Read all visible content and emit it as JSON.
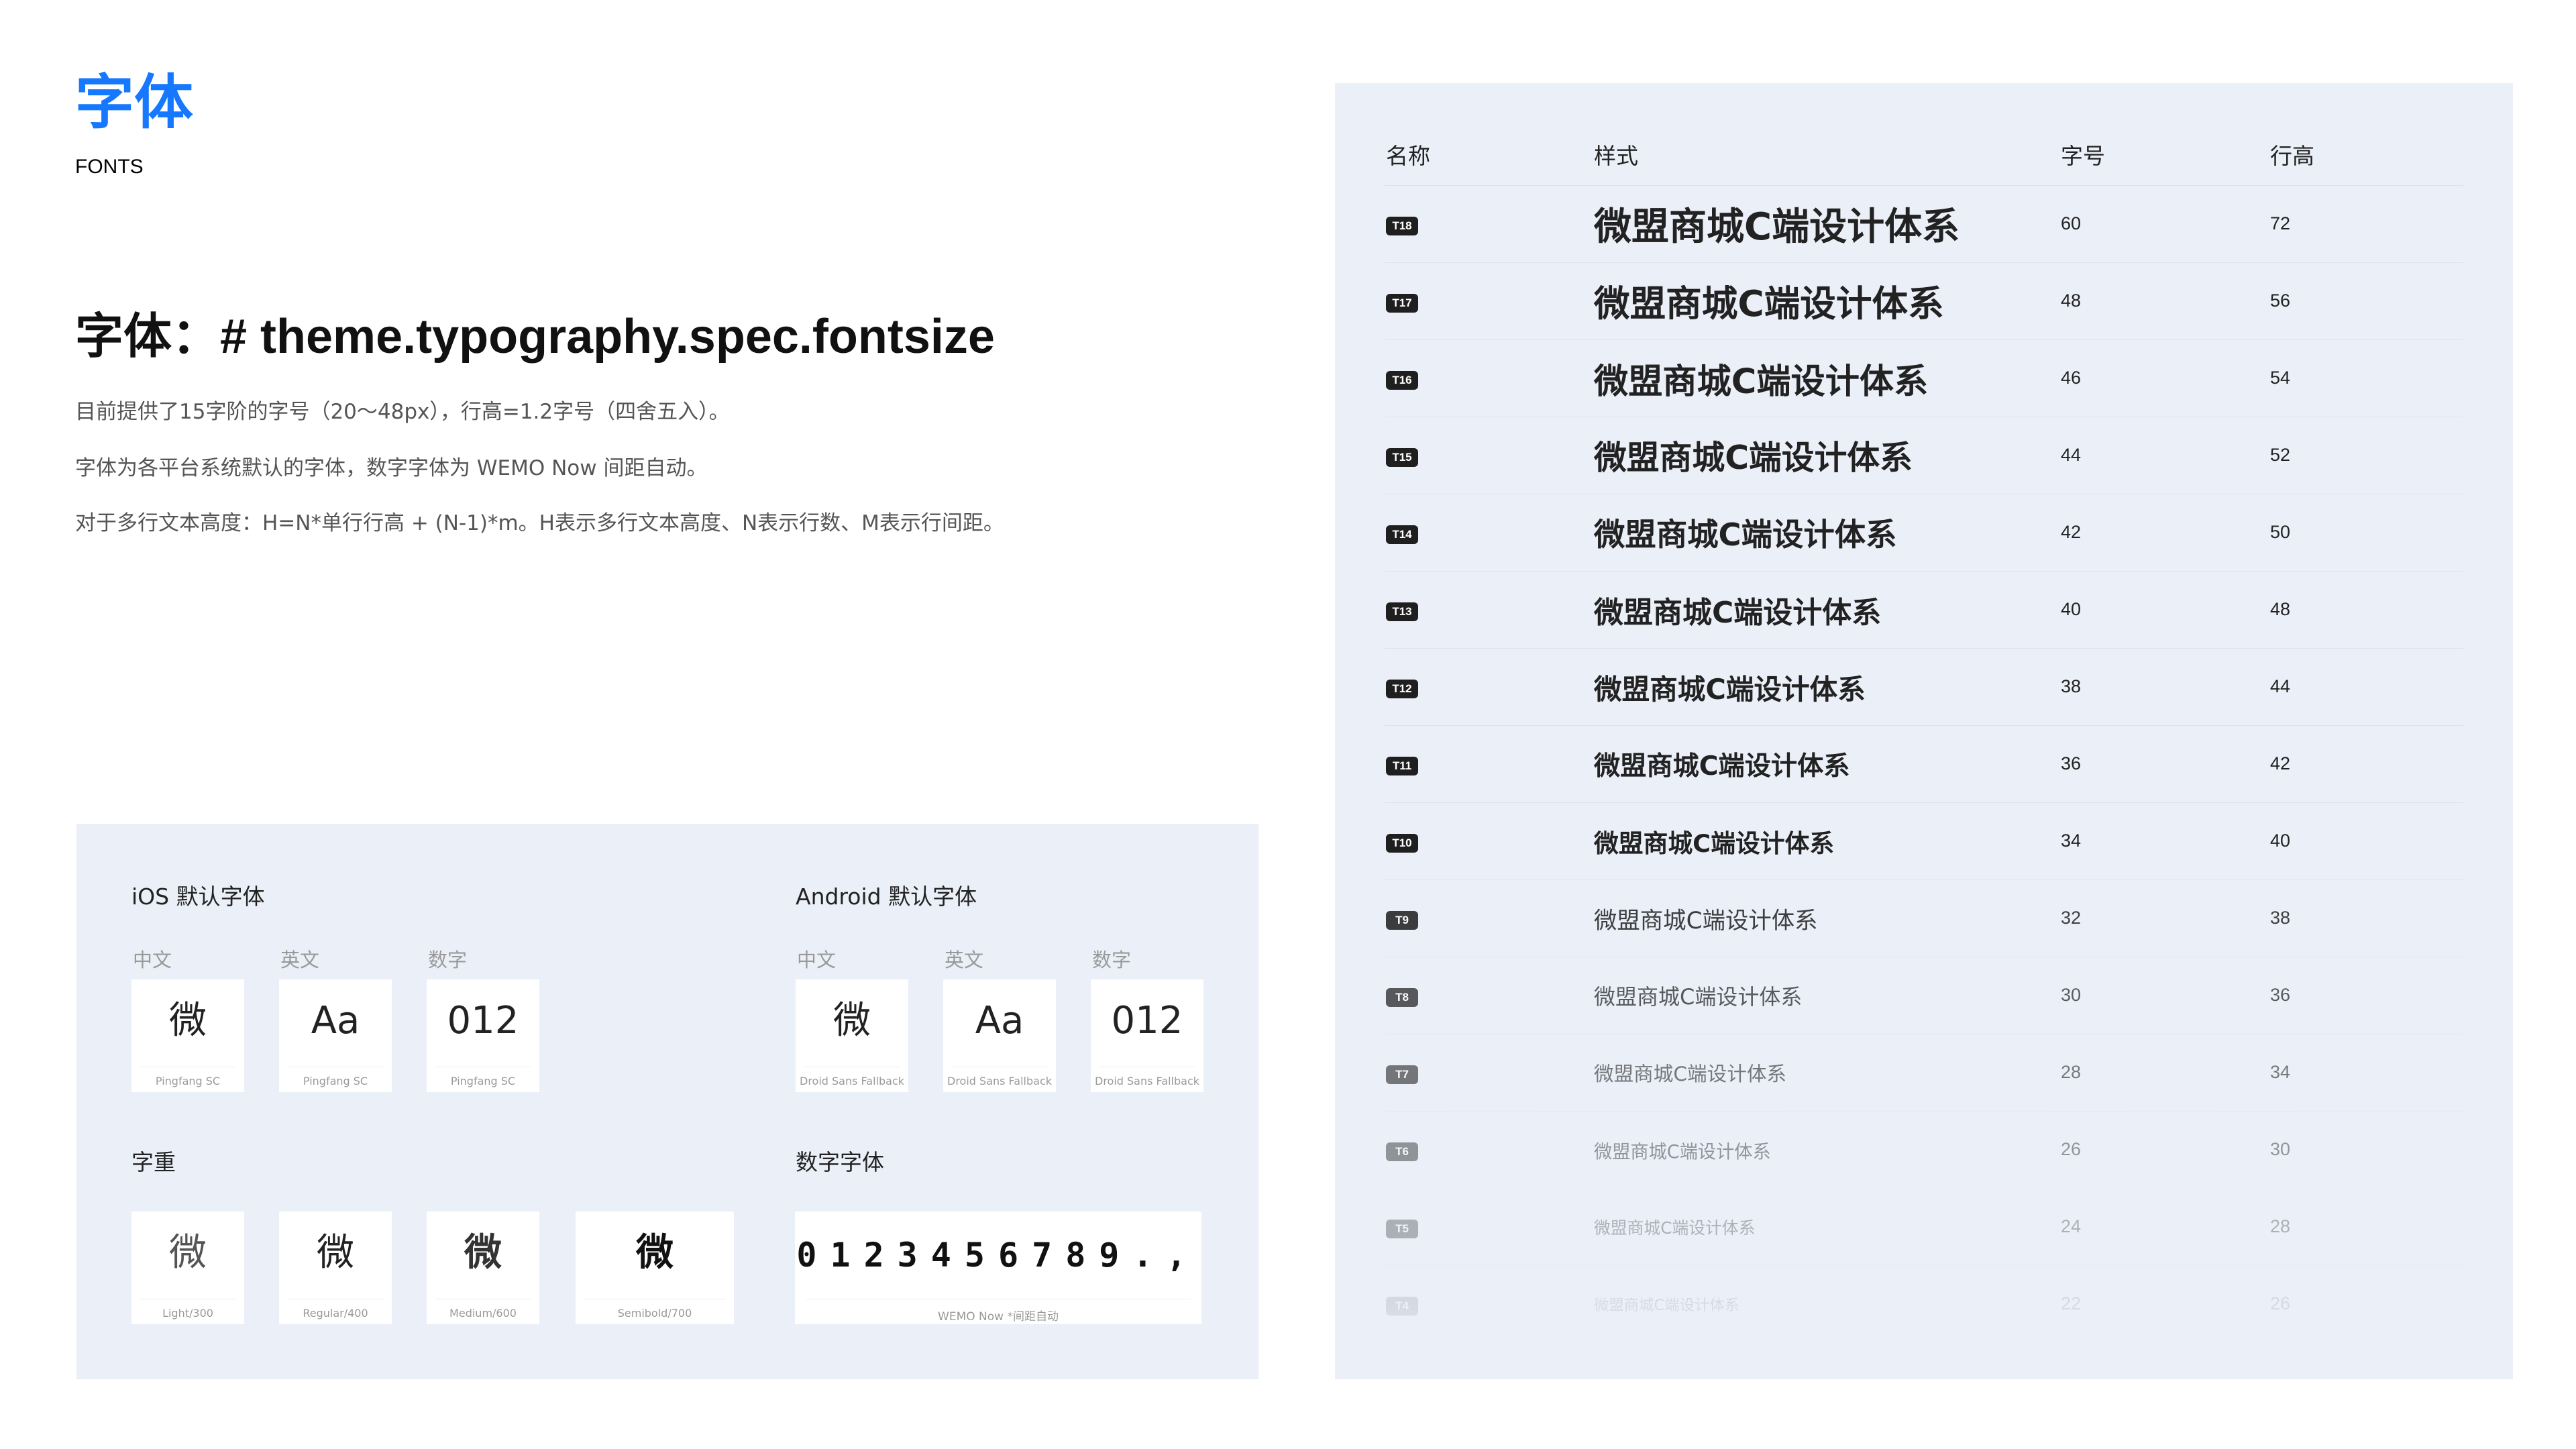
{
  "header": {
    "title": "字体",
    "subtitle": "FONTS"
  },
  "spec": {
    "heading": "字体：# theme.typography.spec.fontsize",
    "lines": [
      "目前提供了15字阶的字号（20～48px），行高=1.2字号（四舍五入）。",
      "字体为各平台系统默认的字体，数字字体为 WEMO Now 间距自动。",
      "对于多行文本高度：H=N*单行行高 + (N-1)*m。H表示多行文本高度、N表示行数、M表示行间距。"
    ]
  },
  "ios": {
    "title": "iOS 默认字体",
    "columns": [
      {
        "label": "中文",
        "glyph": "微",
        "font": "Pingfang SC"
      },
      {
        "label": "英文",
        "glyph": "Aa",
        "font": "Pingfang SC"
      },
      {
        "label": "数字",
        "glyph": "012",
        "font": "Pingfang SC"
      }
    ]
  },
  "android": {
    "title": "Android 默认字体",
    "columns": [
      {
        "label": "中文",
        "glyph": "微",
        "font": "Droid Sans Fallback"
      },
      {
        "label": "英文",
        "glyph": "Aa",
        "font": "Droid Sans Fallback"
      },
      {
        "label": "数字",
        "glyph": "012",
        "font": "Droid Sans Fallback"
      }
    ]
  },
  "weights": {
    "title": "字重",
    "items": [
      {
        "glyph": "微",
        "label": "Light/300"
      },
      {
        "glyph": "微",
        "label": "Regular/400"
      },
      {
        "glyph": "微",
        "label": "Medium/600"
      },
      {
        "glyph": "微",
        "label": "Semibold/700"
      }
    ]
  },
  "numeric_font": {
    "title": "数字字体",
    "sample": "0123456789.,",
    "caption": "WEMO Now  *间距自动"
  },
  "table": {
    "headers": {
      "name": "名称",
      "style": "样式",
      "size": "字号",
      "line_height": "行高"
    },
    "sample_text": "微盟商城C端设计体系",
    "rows": [
      {
        "badge": "T18",
        "size": "60",
        "line_height": "72"
      },
      {
        "badge": "T17",
        "size": "48",
        "line_height": "56"
      },
      {
        "badge": "T16",
        "size": "46",
        "line_height": "54"
      },
      {
        "badge": "T15",
        "size": "44",
        "line_height": "52"
      },
      {
        "badge": "T14",
        "size": "42",
        "line_height": "50"
      },
      {
        "badge": "T13",
        "size": "40",
        "line_height": "48"
      },
      {
        "badge": "T12",
        "size": "38",
        "line_height": "44"
      },
      {
        "badge": "T11",
        "size": "36",
        "line_height": "42"
      },
      {
        "badge": "T10",
        "size": "34",
        "line_height": "40"
      },
      {
        "badge": "T9",
        "size": "32",
        "line_height": "38"
      },
      {
        "badge": "T8",
        "size": "30",
        "line_height": "36"
      },
      {
        "badge": "T7",
        "size": "28",
        "line_height": "34"
      },
      {
        "badge": "T6",
        "size": "26",
        "line_height": "30"
      },
      {
        "badge": "T5",
        "size": "24",
        "line_height": "28"
      },
      {
        "badge": "T4",
        "size": "22",
        "line_height": "26"
      }
    ]
  }
}
